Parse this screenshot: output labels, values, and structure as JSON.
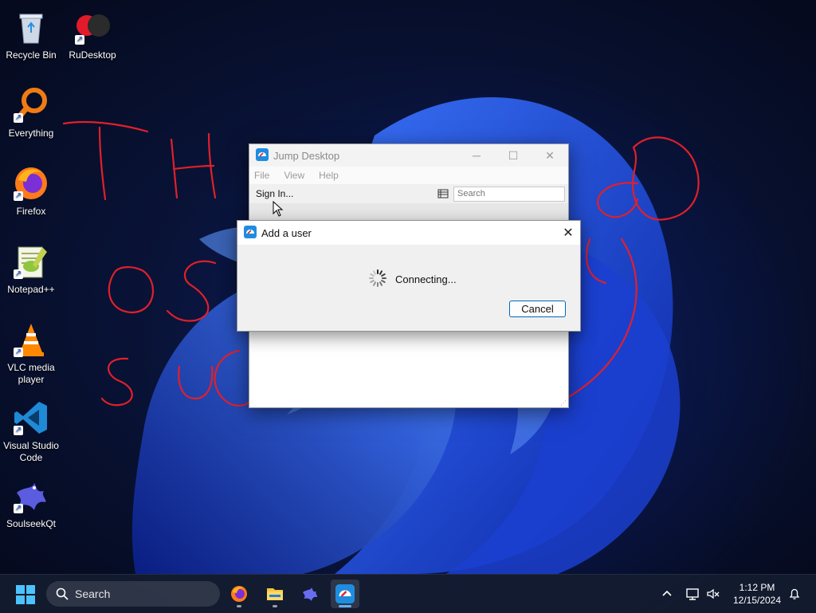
{
  "desktop": {
    "icons": [
      {
        "label": "Recycle Bin",
        "icon": "recycle-bin-icon"
      },
      {
        "label": "RuDesktop",
        "icon": "rudesktop-icon"
      },
      {
        "label": "Everything",
        "icon": "everything-search-icon"
      },
      {
        "label": "Firefox",
        "icon": "firefox-icon"
      },
      {
        "label": "Notepad++",
        "icon": "notepadpp-icon"
      },
      {
        "label": "VLC media player",
        "icon": "vlc-icon"
      },
      {
        "label": "Visual Studio Code",
        "icon": "vscode-icon"
      },
      {
        "label": "SoulseekQt",
        "icon": "soulseek-icon"
      }
    ],
    "scribble_color": "#e0202a"
  },
  "jump_desktop": {
    "title": "Jump Desktop",
    "menu": [
      "File",
      "View",
      "Help"
    ],
    "toolbar": {
      "sign_in": "Sign In..."
    },
    "search_placeholder": "Search"
  },
  "dialog": {
    "title": "Add a user",
    "status": "Connecting...",
    "cancel_label": "Cancel",
    "accent": "#0067c0"
  },
  "taskbar": {
    "search_label": "Search",
    "apps": [
      "firefox-icon",
      "file-explorer-icon",
      "soulseek-icon",
      "jump-desktop-icon"
    ],
    "time": "1:12 PM",
    "date": "12/15/2024"
  }
}
